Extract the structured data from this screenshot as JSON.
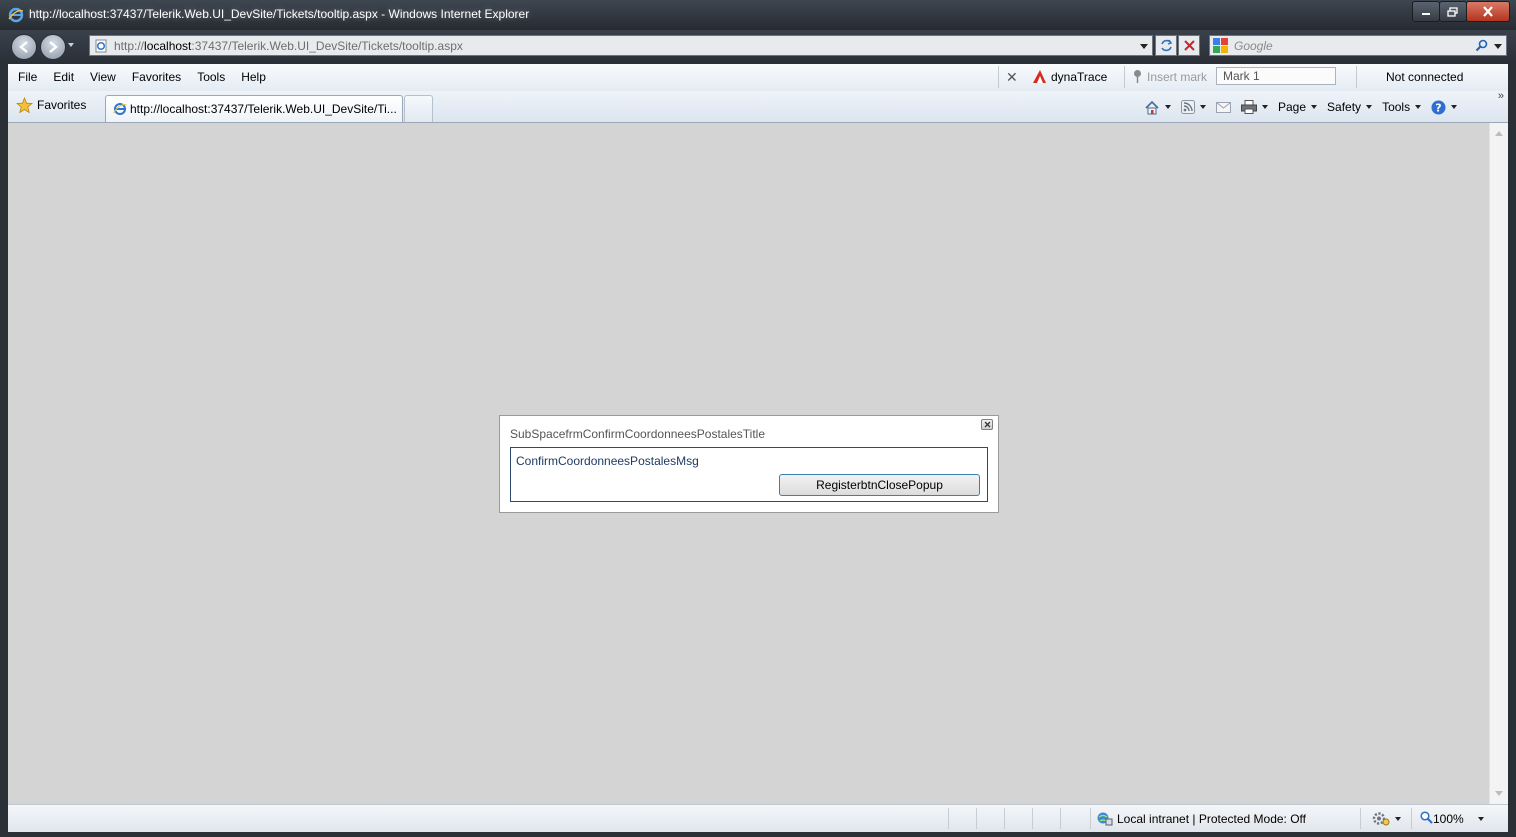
{
  "window": {
    "title": "http://localhost:37437/Telerik.Web.UI_DevSite/Tickets/tooltip.aspx - Windows Internet Explorer"
  },
  "address": {
    "prefix": "http://",
    "host": "localhost",
    "rest": ":37437/Telerik.Web.UI_DevSite/Tickets/tooltip.aspx"
  },
  "search": {
    "placeholder": "Google"
  },
  "menu": {
    "file": "File",
    "edit": "Edit",
    "view": "View",
    "favorites": "Favorites",
    "tools": "Tools",
    "help": "Help"
  },
  "dynatrace": {
    "name": "dynaTrace",
    "insert_mark": "Insert mark",
    "mark_value": "Mark 1",
    "status": "Not connected"
  },
  "favbar": {
    "favorites_label": "Favorites"
  },
  "tab": {
    "label": "http://localhost:37437/Telerik.Web.UI_DevSite/Ti..."
  },
  "commands": {
    "page": "Page",
    "safety": "Safety",
    "tools": "Tools"
  },
  "popup": {
    "title": "SubSpacefrmConfirmCoordonneesPostalesTitle",
    "message": "ConfirmCoordonneesPostalesMsg",
    "button_label": "RegisterbtnClosePopup"
  },
  "status": {
    "zone": "Local intranet | Protected Mode: Off",
    "zoom": "100%"
  },
  "colors": {
    "content_bg": "#d4d4d4",
    "popup_border": "#2d4b6e",
    "button_border": "#3c7fb1"
  }
}
